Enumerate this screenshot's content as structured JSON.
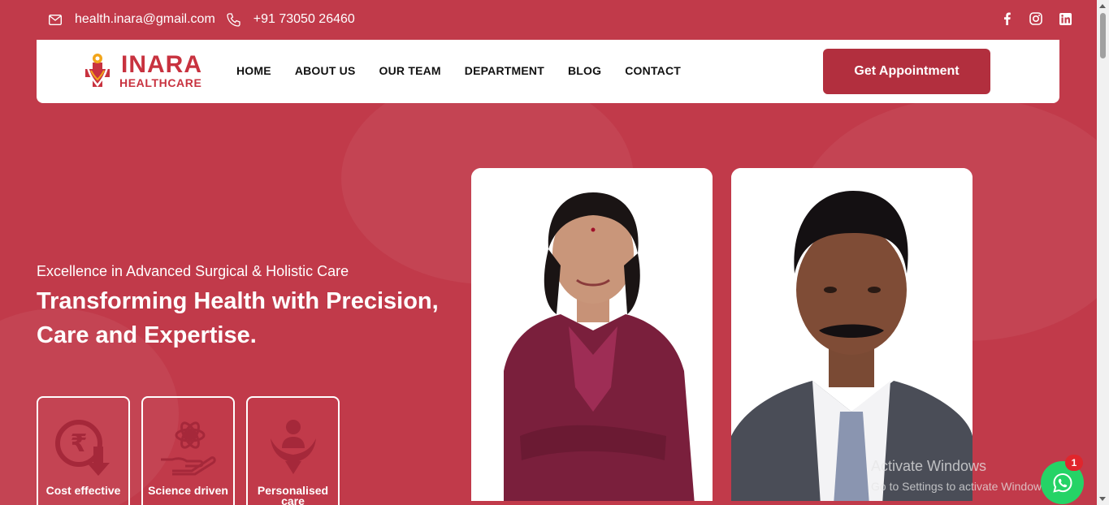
{
  "topbar": {
    "email": "health.inara@gmail.com",
    "phone": "+91 73050 26460",
    "social_icons": [
      "facebook-icon",
      "instagram-icon",
      "linkedin-icon"
    ]
  },
  "brand": {
    "name_line1": "INARA",
    "name_line2": "HEALTHCARE",
    "color": "#c8323f"
  },
  "nav": {
    "items": [
      "HOME",
      "ABOUT US",
      "OUR TEAM",
      "DEPARTMENT",
      "BLOG",
      "CONTACT"
    ],
    "cta": "Get Appointment"
  },
  "hero": {
    "subtitle": "Excellence in Advanced Surgical & Holistic Care",
    "headline": "Transforming Health with Precision, Care and Expertise.",
    "features": [
      {
        "label": "Cost effective",
        "icon": "rupee-down-icon"
      },
      {
        "label": "Science driven",
        "icon": "hand-atom-icon"
      },
      {
        "label": "Personalised care",
        "icon": "care-hands-icon"
      }
    ]
  },
  "overlay": {
    "activate_title": "Activate Windows",
    "activate_sub": "Go to Settings to activate Windows.",
    "whatsapp_badge": "1"
  },
  "colors": {
    "background": "#c13a4a",
    "accent": "#b22f3e",
    "whatsapp": "#25d366"
  }
}
